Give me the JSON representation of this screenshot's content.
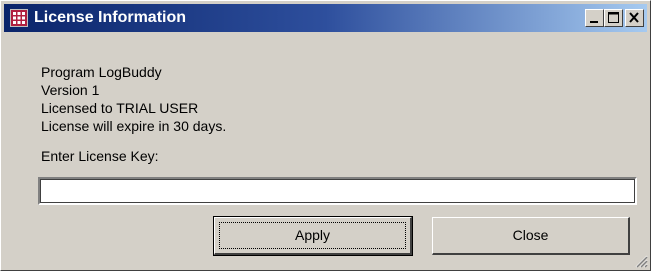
{
  "window": {
    "title": "License Information",
    "controls": {
      "minimize_icon": "minimize-icon",
      "maximize_icon": "maximize-icon",
      "close_icon": "close-icon"
    }
  },
  "info": {
    "program": "Program LogBuddy",
    "version": "Version 1",
    "licensed_to": "Licensed to TRIAL USER",
    "expiry": "License will expire in 30 days."
  },
  "license_key": {
    "label": "Enter License Key:",
    "value": "",
    "placeholder": ""
  },
  "buttons": {
    "apply": "Apply",
    "close": "Close"
  },
  "colors": {
    "titlebar_start": "#0a246a",
    "titlebar_end": "#a6caf0",
    "dialog_bg": "#d4d0c8"
  }
}
